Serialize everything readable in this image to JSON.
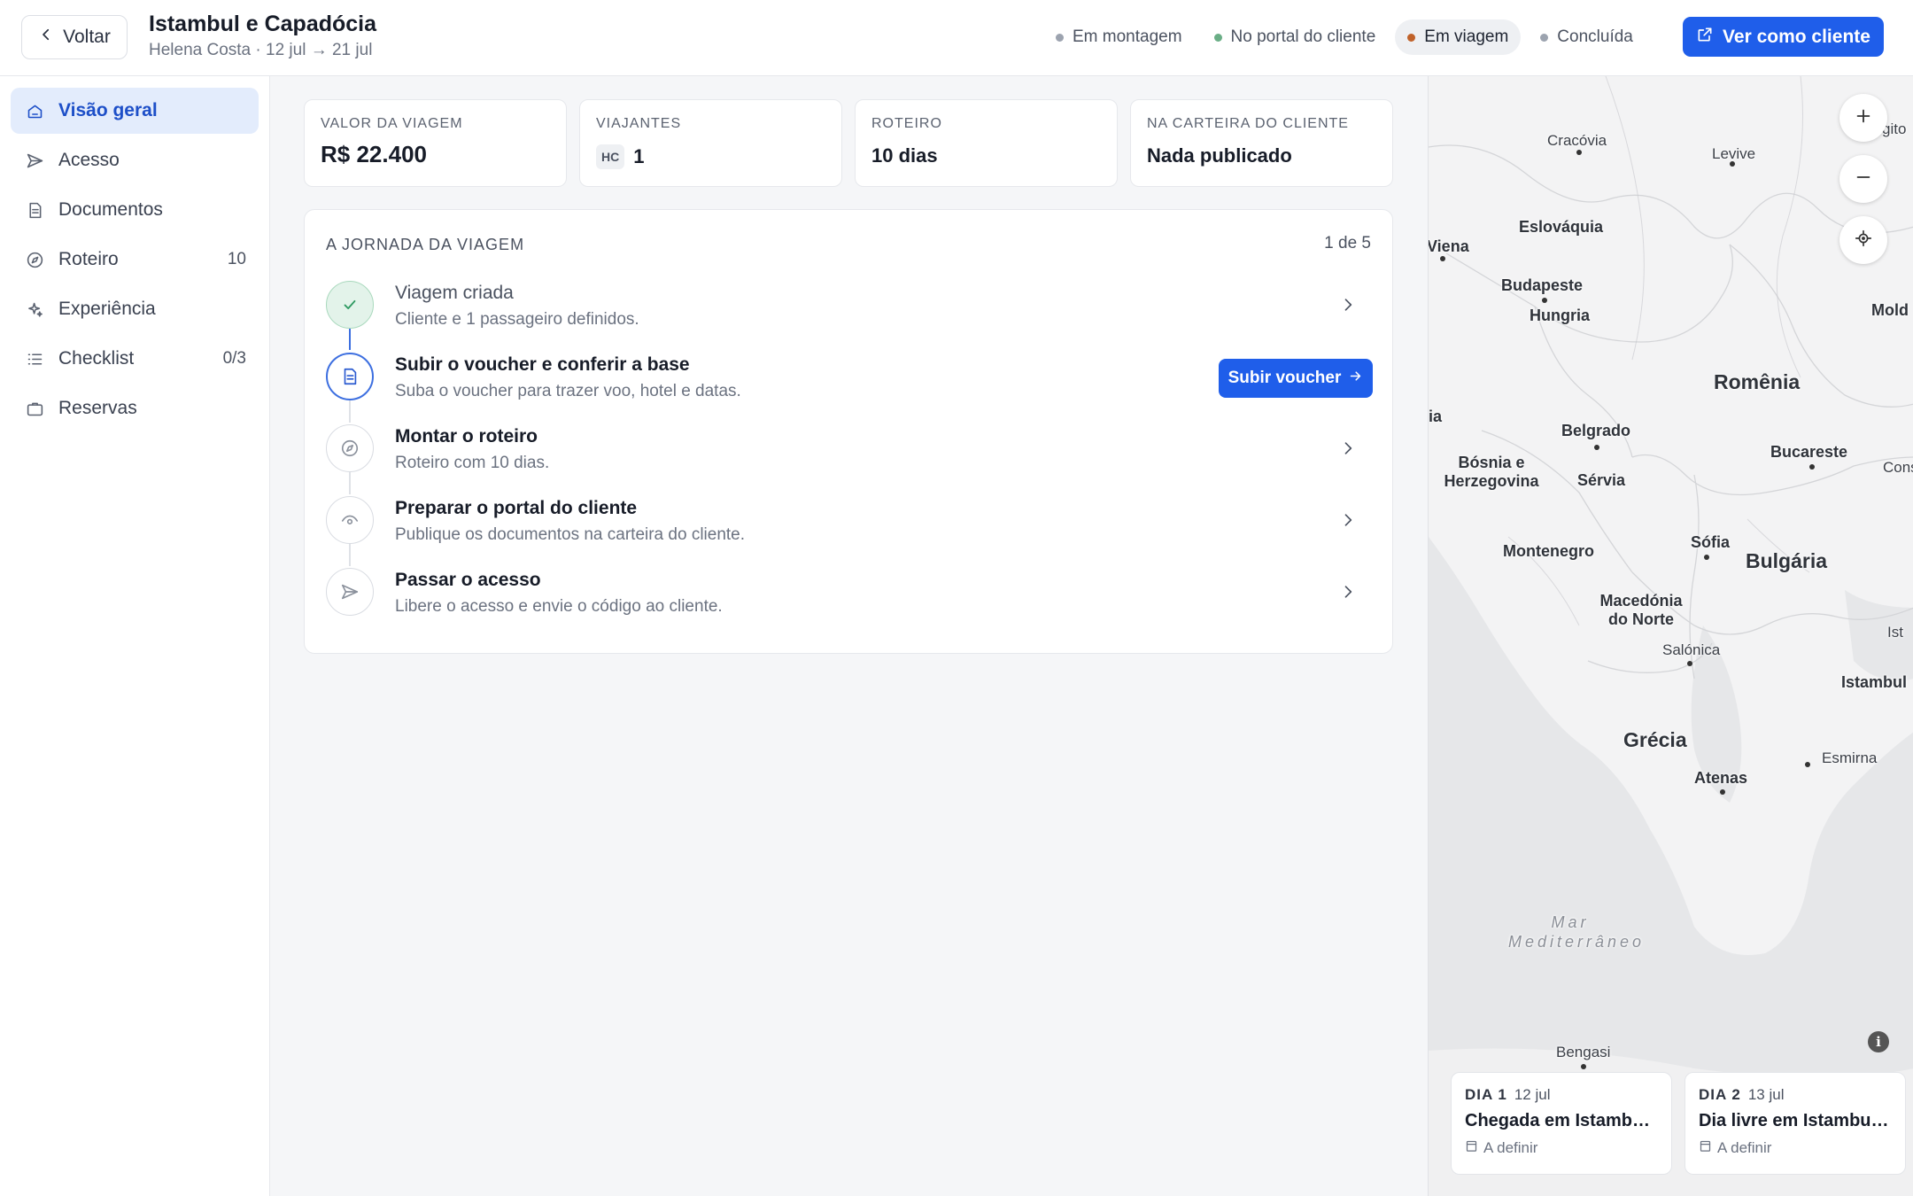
{
  "header": {
    "back_label": "Voltar",
    "title": "Istambul e Capadócia",
    "subtitle": "Helena Costa · 12 jul → 21 jul",
    "statuses": [
      {
        "label": "Em montagem",
        "color": "#9ca3af",
        "active": false
      },
      {
        "label": "No portal do cliente",
        "color": "#6aae86",
        "active": false
      },
      {
        "label": "Em viagem",
        "color": "#c0622a",
        "active": true
      },
      {
        "label": "Concluída",
        "color": "#9ca3af",
        "active": false
      }
    ],
    "view_as_client_label": "Ver como cliente",
    "accent": "#1f5eea"
  },
  "sidebar": {
    "items": [
      {
        "label": "Visão geral",
        "icon": "home-icon",
        "count": ""
      },
      {
        "label": "Acesso",
        "icon": "send-icon",
        "count": ""
      },
      {
        "label": "Documentos",
        "icon": "document-icon",
        "count": ""
      },
      {
        "label": "Roteiro",
        "icon": "compass-icon",
        "count": "10"
      },
      {
        "label": "Experiência",
        "icon": "sparkle-icon",
        "count": ""
      },
      {
        "label": "Checklist",
        "icon": "checklist-icon",
        "count": "0/3"
      },
      {
        "label": "Reservas",
        "icon": "briefcase-icon",
        "count": ""
      }
    ]
  },
  "stats": [
    {
      "label": "VALOR DA VIAGEM",
      "value": "R$ 22.400"
    },
    {
      "label": "VIAJANTES",
      "chip": "HC",
      "value": "1"
    },
    {
      "label": "ROTEIRO",
      "value": "10 dias"
    },
    {
      "label": "NA CARTEIRA DO CLIENTE",
      "value": "Nada publicado"
    }
  ],
  "journey": {
    "title": "A JORNADA DA VIAGEM",
    "count": "1 de 5",
    "steps": [
      {
        "title": "Viagem criada",
        "desc": "Cliente e 1 passageiro definidos.",
        "state": "done"
      },
      {
        "title": "Subir o voucher e conferir a base",
        "desc": "Suba o voucher para trazer voo, hotel e datas.",
        "state": "current",
        "action": "Subir voucher"
      },
      {
        "title": "Montar o roteiro",
        "desc": "Roteiro com 10 dias.",
        "state": "todo"
      },
      {
        "title": "Preparar o portal do cliente",
        "desc": "Publique os documentos na carteira do cliente.",
        "state": "todo"
      },
      {
        "title": "Passar o acesso",
        "desc": "Libere o acesso e envie o código ao cliente.",
        "state": "todo"
      }
    ]
  },
  "map": {
    "labels": [
      {
        "text": "Cracóvia",
        "kind": "city"
      },
      {
        "text": "Levive",
        "kind": "city"
      },
      {
        "text": "Eslováquia",
        "kind": "country"
      },
      {
        "text": "Viena",
        "kind": "city"
      },
      {
        "text": "Budapeste",
        "kind": "country"
      },
      {
        "text": "Hungria",
        "kind": "country"
      },
      {
        "text": "Mold",
        "kind": "country"
      },
      {
        "text": "Romênia",
        "kind": "bigcountry"
      },
      {
        "text": "ia",
        "kind": "country"
      },
      {
        "text": "Belgrado",
        "kind": "country"
      },
      {
        "text": "Bucareste",
        "kind": "country"
      },
      {
        "text": "Cons",
        "kind": "city"
      },
      {
        "text": "Bósnia e Herzegovina",
        "kind": "country"
      },
      {
        "text": "Sérvia",
        "kind": "country"
      },
      {
        "text": "Montenegro",
        "kind": "country"
      },
      {
        "text": "Sófia",
        "kind": "country"
      },
      {
        "text": "Bulgária",
        "kind": "bigcountry"
      },
      {
        "text": "Macedónia do Norte",
        "kind": "country"
      },
      {
        "text": "Ist",
        "kind": "city"
      },
      {
        "text": "Salónica",
        "kind": "city"
      },
      {
        "text": "Istambul",
        "kind": "country"
      },
      {
        "text": "Grécia",
        "kind": "bigcountry"
      },
      {
        "text": "Esmirna",
        "kind": "city"
      },
      {
        "text": "Atenas",
        "kind": "country"
      },
      {
        "text": "Mar Mediterrâneo",
        "kind": "sea"
      },
      {
        "text": "Bengasi",
        "kind": "city"
      },
      {
        "text": "gito",
        "kind": "city"
      }
    ],
    "info_icon": "i",
    "days": [
      {
        "day": "DIA 1",
        "date": "12 jul",
        "title": "Chegada em Istambul e Bósforo",
        "status": "A definir"
      },
      {
        "day": "DIA 2",
        "date": "13 jul",
        "title": "Dia livre em Istambul e Bazar",
        "status": "A definir"
      }
    ]
  }
}
